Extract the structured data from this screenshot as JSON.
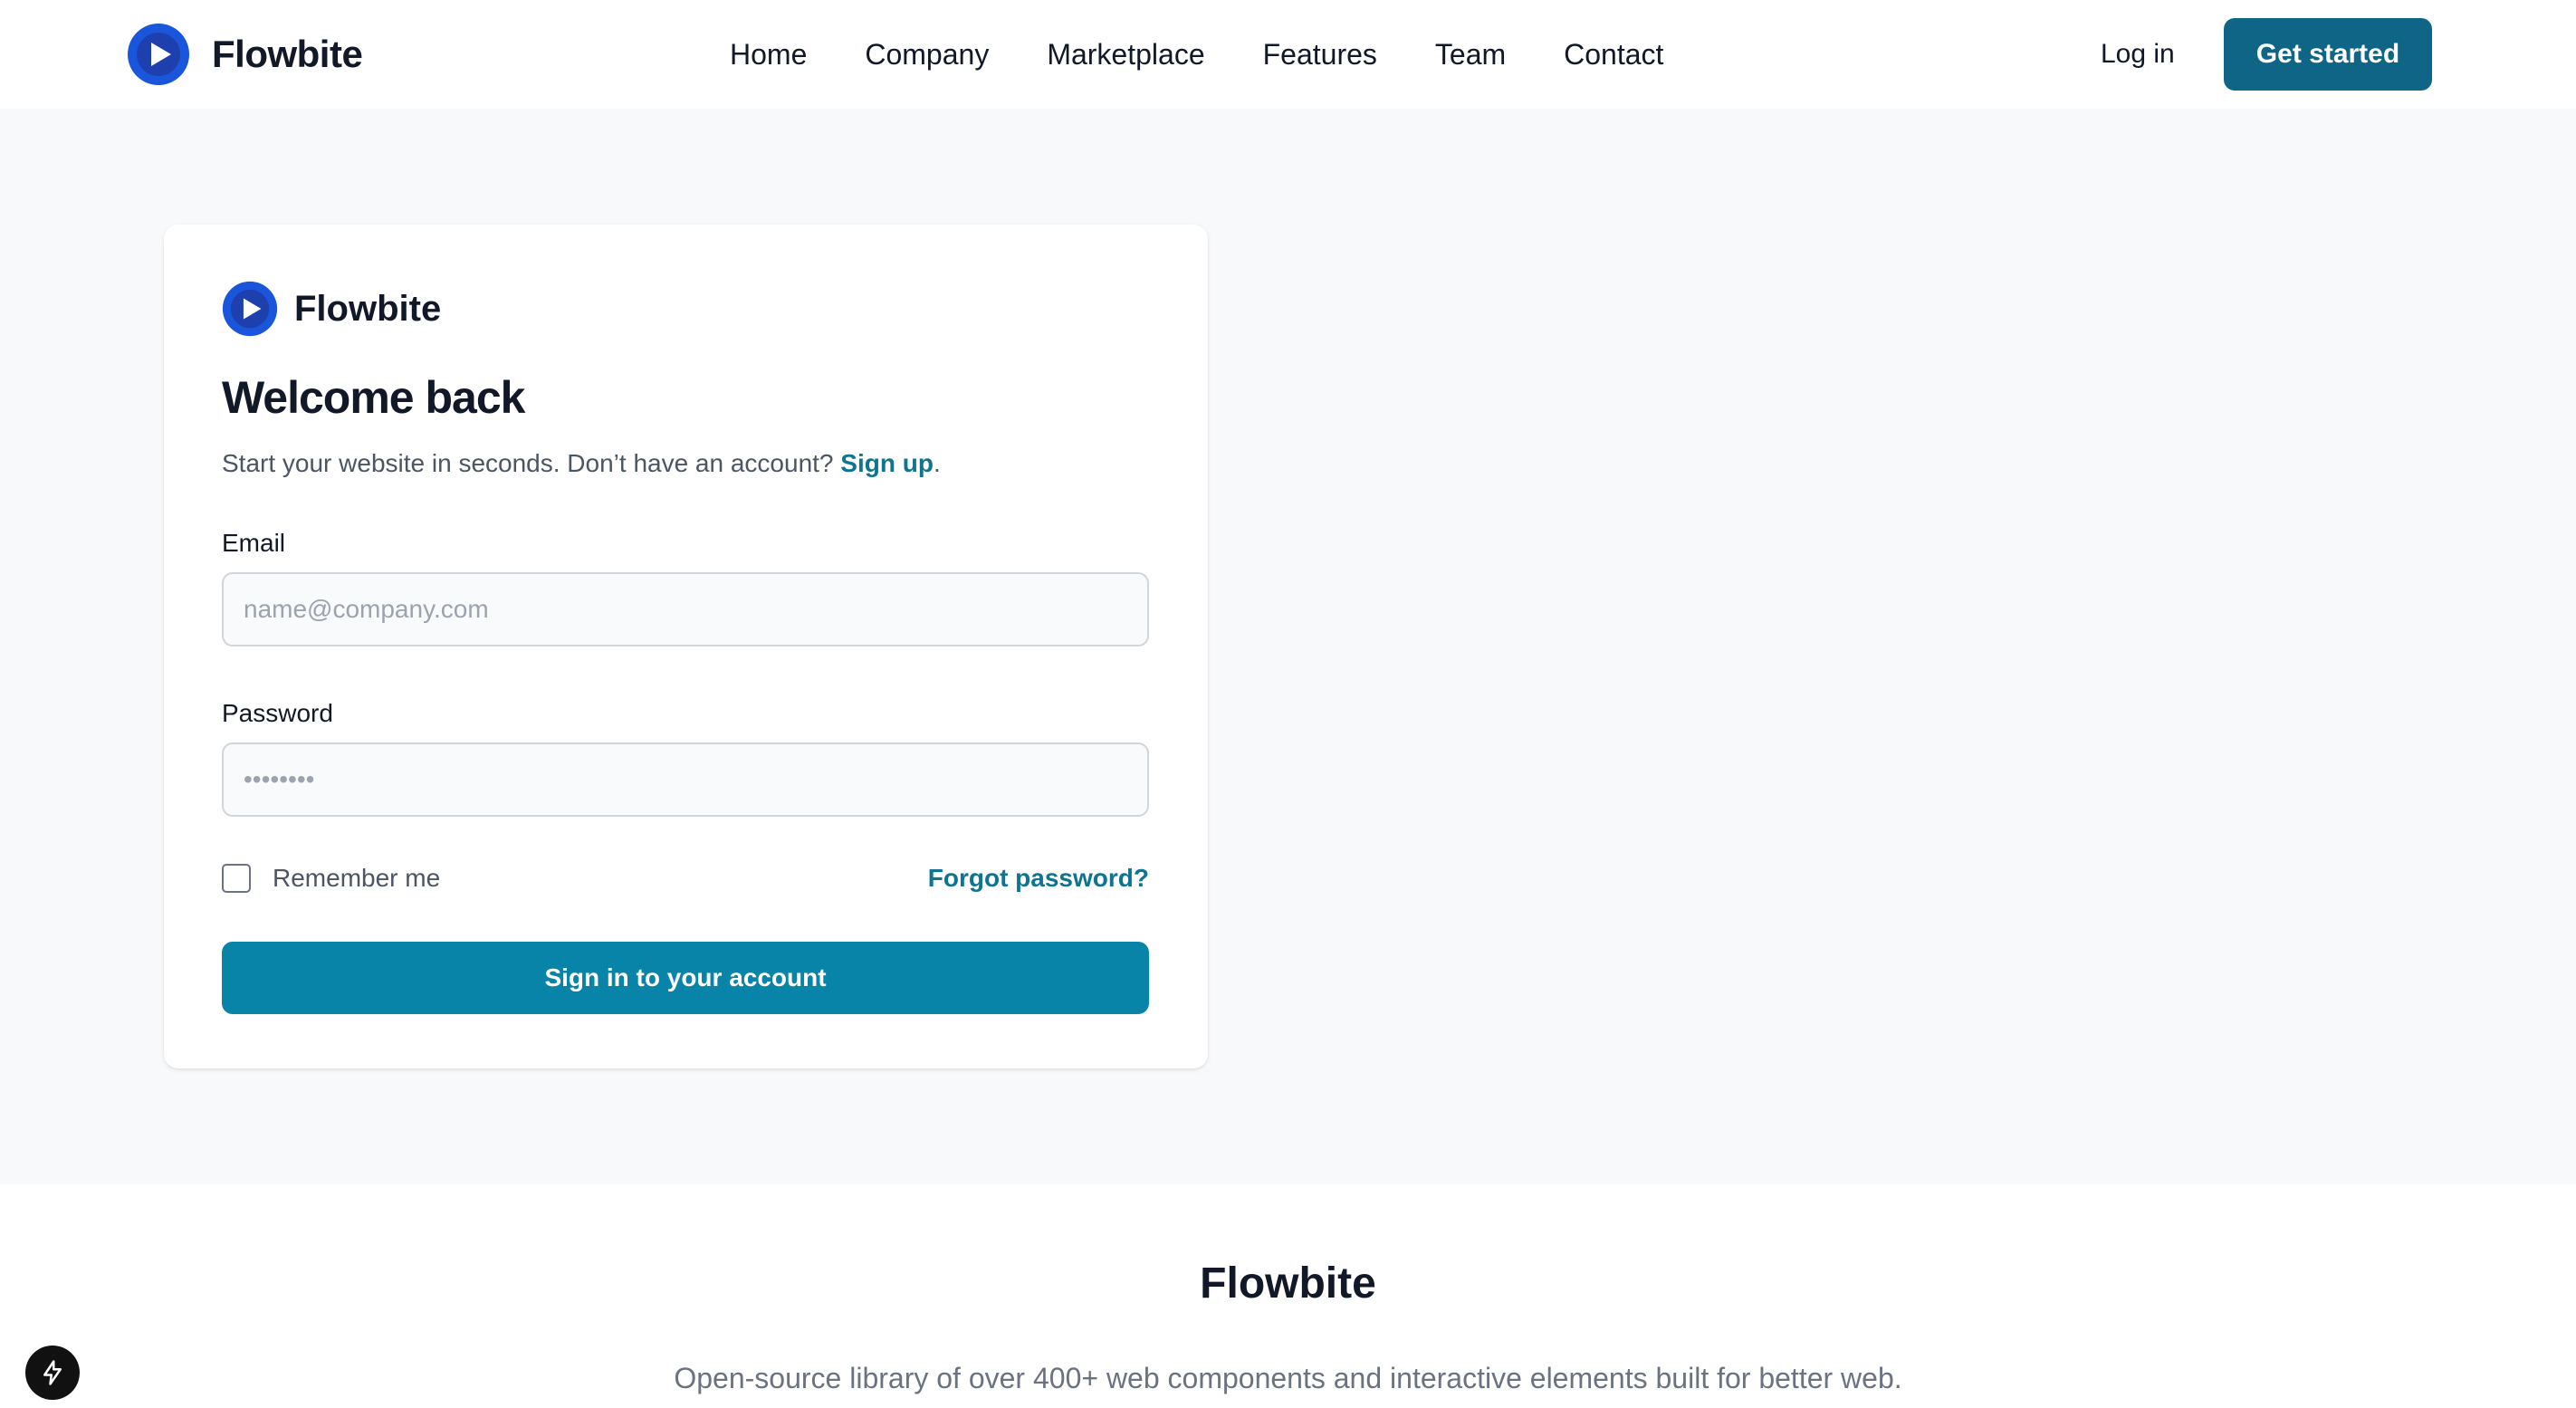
{
  "navbar": {
    "brand": "Flowbite",
    "links": [
      "Home",
      "Company",
      "Marketplace",
      "Features",
      "Team",
      "Contact"
    ],
    "login_label": "Log in",
    "cta_label": "Get started"
  },
  "login_card": {
    "brand": "Flowbite",
    "heading": "Welcome back",
    "subtitle_text": "Start your website in seconds. Don’t have an account? ",
    "signup_link": "Sign up",
    "subtitle_end": ".",
    "email_label": "Email",
    "email_placeholder": "name@company.com",
    "password_label": "Password",
    "password_placeholder": "••••••••",
    "remember_label": "Remember me",
    "forgot_label": "Forgot password?",
    "submit_label": "Sign in to your account"
  },
  "footer": {
    "title": "Flowbite",
    "description": "Open-source library of over 400+ web components and interactive elements built for better web."
  },
  "colors": {
    "primary": "#0784a8",
    "cta_dark": "#0e6585",
    "link": "#0e7490",
    "logo_blue": "#1a56db"
  },
  "icons": {
    "brand_logo": "play-circle-logo-icon",
    "badge": "lightning-bolt-icon"
  }
}
